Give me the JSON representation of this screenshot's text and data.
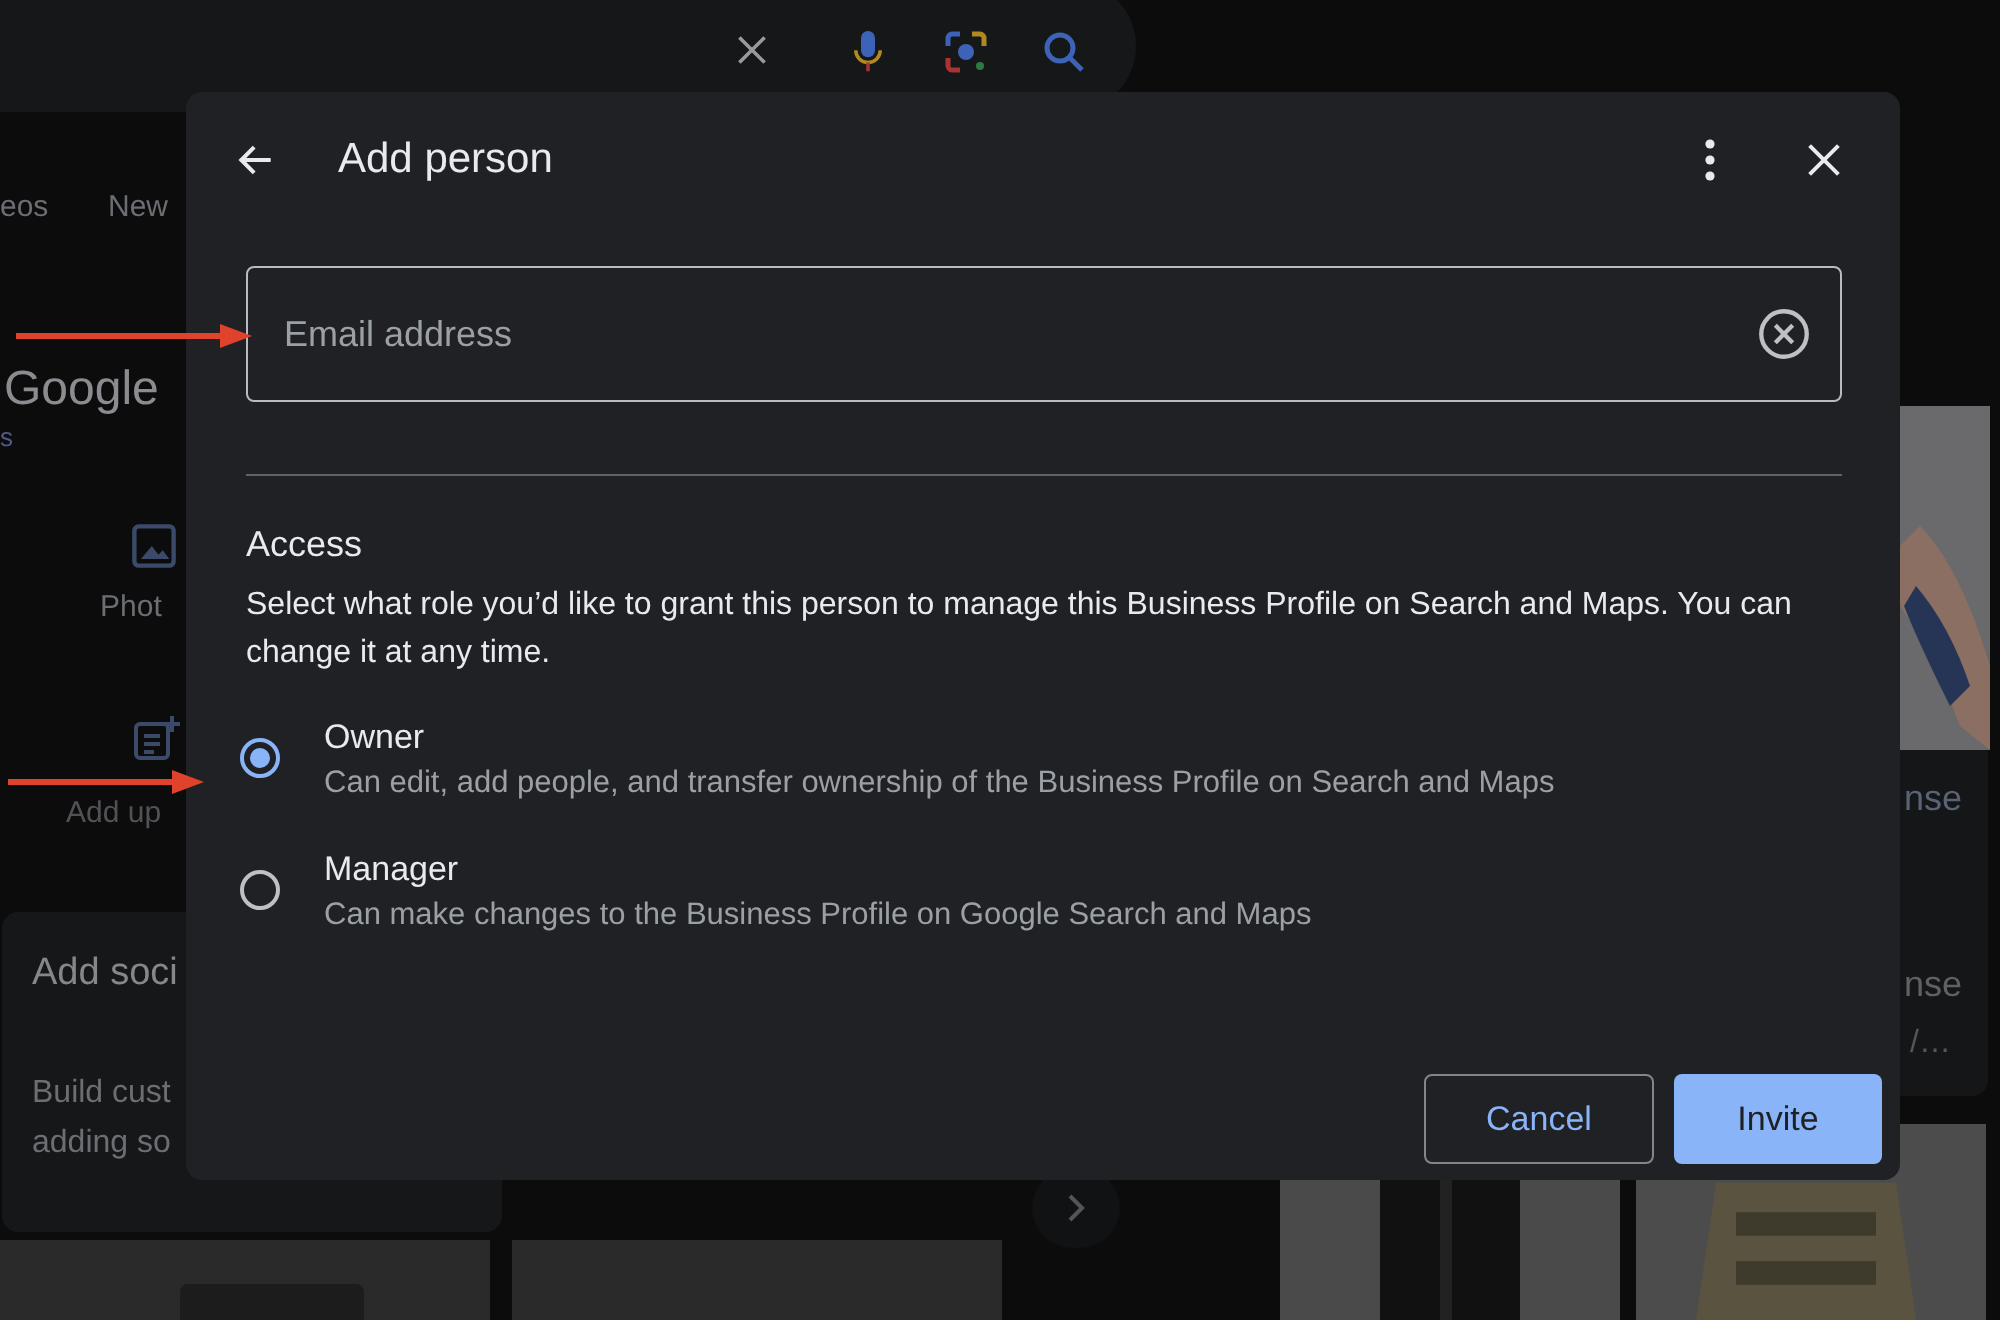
{
  "background": {
    "tabs": [
      "eos",
      "New"
    ],
    "title": "Google",
    "link": "s",
    "actions": [
      "Phot",
      "Add up"
    ],
    "card": {
      "title": "Add soci",
      "lines": [
        "Build cust",
        "adding so"
      ]
    },
    "side_texts": [
      "nse",
      "nse",
      "/…"
    ]
  },
  "dialog": {
    "title": "Add person",
    "email": {
      "placeholder": "Email address"
    },
    "access_heading": "Access",
    "access_text": "Select what role you’d like to grant this person to manage this Business Profile on Search and Maps. You can change it at any time.",
    "roles": [
      {
        "label": "Owner",
        "description": "Can edit, add people, and transfer ownership of the Business Profile on Search and Maps",
        "selected": true
      },
      {
        "label": "Manager",
        "description": "Can make changes to the Business Profile on Google Search and Maps",
        "selected": false
      }
    ],
    "buttons": [
      {
        "label": "Cancel",
        "kind": "outlined"
      },
      {
        "label": "Invite",
        "kind": "filled"
      }
    ]
  }
}
